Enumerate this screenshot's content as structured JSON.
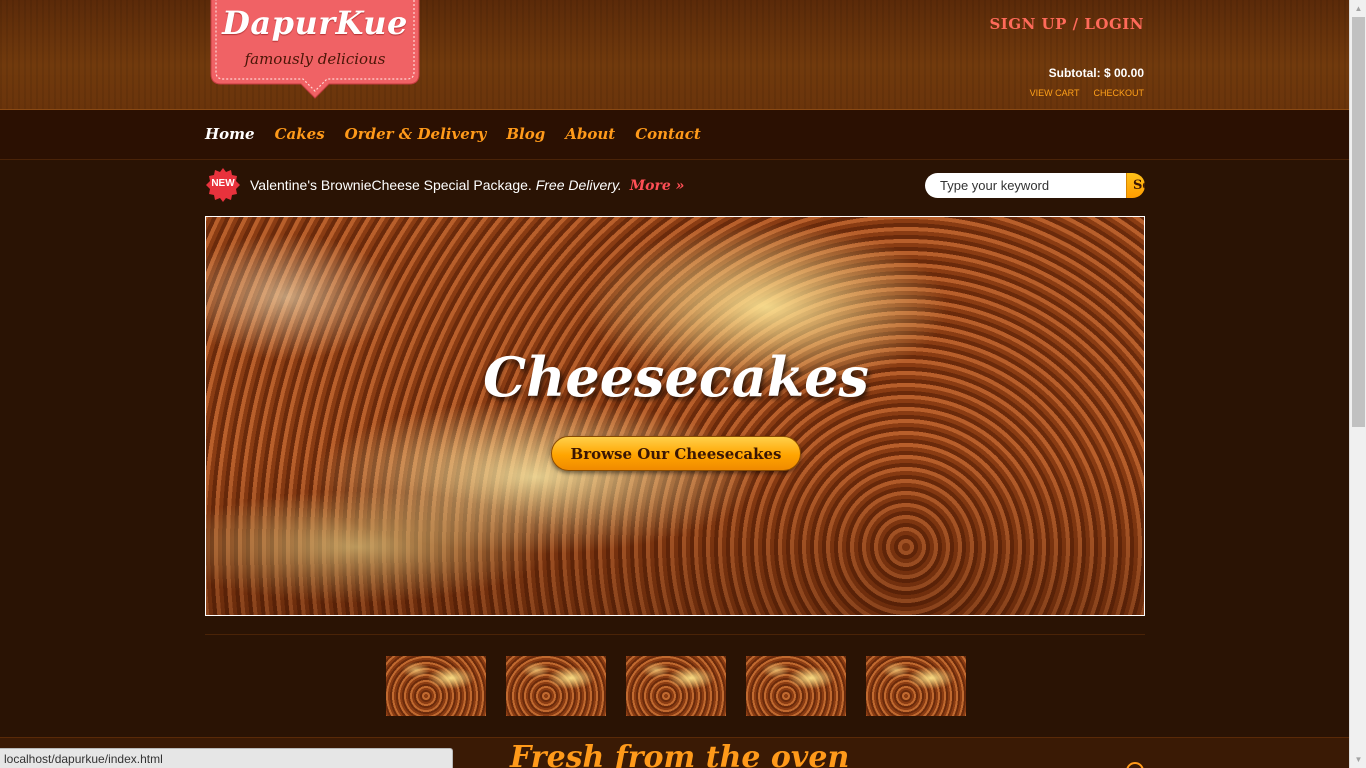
{
  "header": {
    "logo_title": "DapurKue",
    "logo_tagline": "famously delicious",
    "auth": {
      "signup": "SIGN UP",
      "separator": " / ",
      "login": "LOGIN"
    },
    "subtotal": "Subtotal: $ 00.00",
    "view_cart": "VIEW CART",
    "checkout": "CHECKOUT"
  },
  "nav": {
    "items": [
      {
        "label": "Home",
        "active": true
      },
      {
        "label": "Cakes"
      },
      {
        "label": "Order & Delivery"
      },
      {
        "label": "Blog"
      },
      {
        "label": "About"
      },
      {
        "label": "Contact"
      }
    ]
  },
  "promo": {
    "badge": "NEW",
    "text": "Valentine's BrownieCheese Special Package. ",
    "free": "Free Delivery.",
    "more": "More »"
  },
  "search": {
    "placeholder": "Type your keyword",
    "button": "Search"
  },
  "hero": {
    "title": "Cheesecakes",
    "cta": "Browse Our Cheesecakes"
  },
  "thumbnails": {
    "count": 5
  },
  "section": {
    "title": "Fresh from the oven"
  },
  "status_bar": {
    "url": "localhost/dapurkue/index.html"
  },
  "colors": {
    "background": "#2a1304",
    "accent_orange": "#ff9a1a",
    "accent_coral": "#ff6a5a",
    "logo_pink": "#f06265"
  }
}
